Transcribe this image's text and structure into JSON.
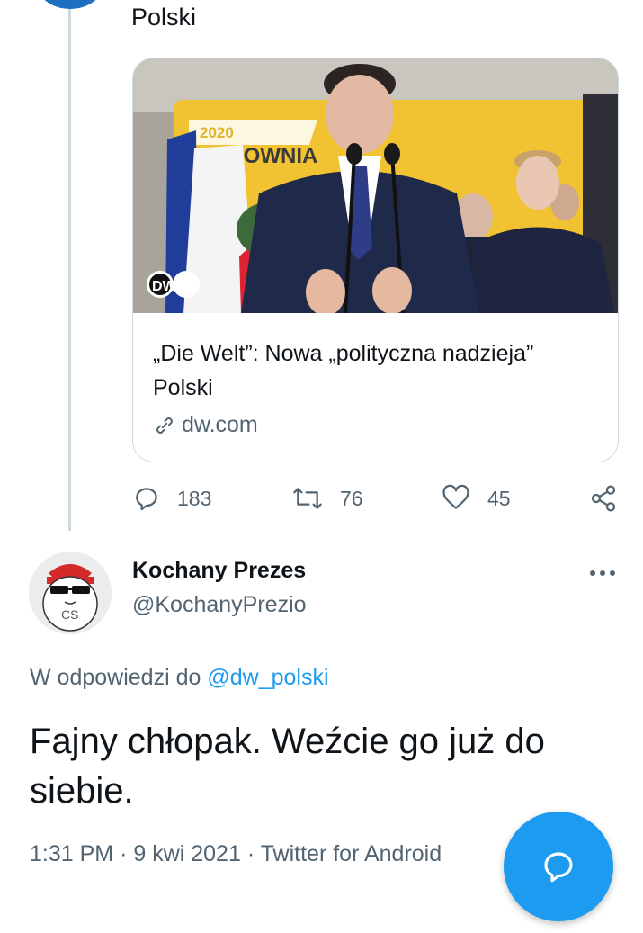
{
  "previous_tweet": {
    "text_tail": "Polski",
    "card": {
      "image_alt": "Speaker at podium with microphones in front of yellow banner",
      "banner_text": "HOŁOWNIA",
      "banner_year": "2020",
      "badge": "DW",
      "title": "„Die Welt”: Nowa „polityczna nadzieja” Polski",
      "domain": "dw.com"
    },
    "stats": {
      "replies": "183",
      "retweets": "76",
      "likes": "45"
    }
  },
  "reply": {
    "author_name": "Kochany Prezes",
    "author_handle": "@KochanyPrezio",
    "avatar_text": "CS",
    "reply_to_prefix": "W odpowiedzi do",
    "reply_to_handle": "@dw_polski",
    "text": "Fajny chłopak. Weźcie go już do siebie.",
    "time": "1:31 PM",
    "date": "9 kwi 2021",
    "source": "Twitter for Android"
  },
  "colors": {
    "accent": "#1d9bf0",
    "secondary_text": "#536471",
    "border": "#cfd9de"
  },
  "icons": [
    "reply-icon",
    "retweet-icon",
    "like-icon",
    "share-icon",
    "more-icon",
    "link-icon",
    "compose-reply-icon"
  ]
}
